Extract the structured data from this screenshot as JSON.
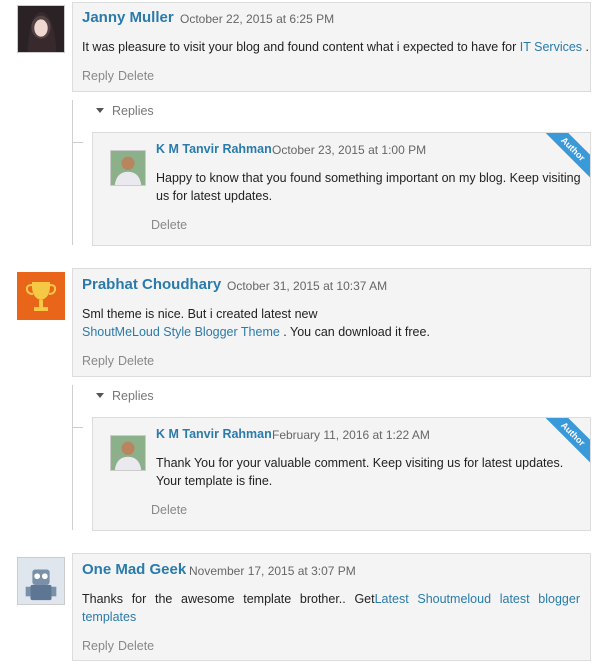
{
  "comments": [
    {
      "author": "Janny Muller",
      "date": "October 22, 2015 at 6:25 PM",
      "text_before": "It was pleasure to visit your blog and found content what i expected to have for ",
      "link": "IT Services",
      "text_after": " .",
      "reply_label": "Reply",
      "delete_label": "Delete",
      "replies_label": "Replies",
      "reply": {
        "author": "K M Tanvir Rahman",
        "date": "October 23, 2015 at 1:00 PM",
        "text": "Happy to know that you found something important on my blog. Keep visiting us for latest updates.",
        "delete_label": "Delete",
        "badge": "Author"
      }
    },
    {
      "author": "Prabhat Choudhary",
      "date": "October 31, 2015 at 10:37 AM",
      "text_before": "Sml theme is nice. But i created latest new",
      "link": "ShoutMeLoud Style Blogger Theme",
      "text_after": " . You can download it free.",
      "reply_label": "Reply",
      "delete_label": "Delete",
      "replies_label": "Replies",
      "reply": {
        "author": "K M Tanvir Rahman",
        "date": "February 11, 2016 at 1:22 AM",
        "text": "Thank You for your valuable comment. Keep visiting us for latest updates. Your template is fine.",
        "delete_label": "Delete",
        "badge": "Author"
      }
    },
    {
      "author": "One Mad Geek",
      "date": "November 17, 2015 at 3:07 PM",
      "text_before": "Thanks for the awesome template brother.. Get",
      "link": "Latest Shoutmeloud latest blogger templates",
      "reply_label": "Reply",
      "delete_label": "Delete"
    }
  ],
  "colors": {
    "link": "#2a7bab",
    "badge": "#3a9ad9",
    "box_bg": "#f4f4f4"
  }
}
